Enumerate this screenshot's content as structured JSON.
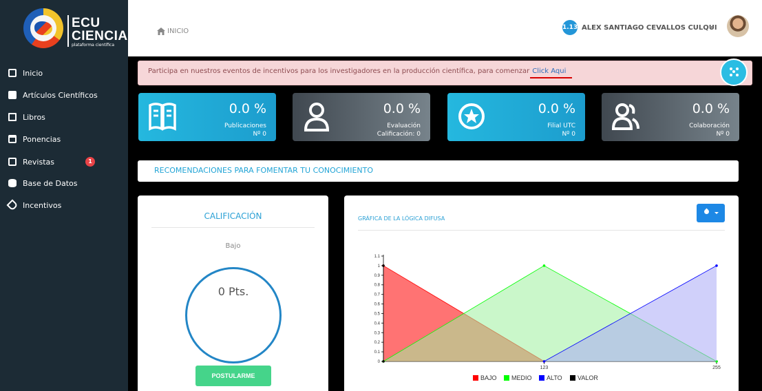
{
  "brand": {
    "line1": "ECU",
    "line2": "CIENCIA",
    "subtitle": "plataforma científica"
  },
  "sidebar": {
    "items": [
      {
        "label": "Inicio",
        "icon": "square-icon"
      },
      {
        "label": "Artículos Científicos",
        "icon": "edit-icon"
      },
      {
        "label": "Libros",
        "icon": "book-icon"
      },
      {
        "label": "Ponencias",
        "icon": "calendar-icon"
      },
      {
        "label": "Revistas",
        "icon": "newspaper-icon",
        "badge": "1"
      },
      {
        "label": "Base de Datos",
        "icon": "database-icon"
      },
      {
        "label": "Incentivos",
        "icon": "tag-icon"
      }
    ]
  },
  "topbar": {
    "breadcrumb": "INICIO",
    "level": "1.13",
    "user_name": "ALEX SANTIAGO CEVALLOS CULQUI"
  },
  "alert": {
    "text": "Participa en nuestros eventos de incentivos para los investigadores en la producción científica, para comenzar",
    "link": "Click Aqui"
  },
  "cards": [
    {
      "percent": "0.0 %",
      "line1": "Publicaciones",
      "line2": "Nº 0",
      "icon": "book-open-icon",
      "color": "#25b8df"
    },
    {
      "percent": "0.0 %",
      "line1": "Evaluación",
      "line2": "Calificación: 0",
      "icon": "user-icon",
      "color": "#5a646c"
    },
    {
      "percent": "0.0 %",
      "line1": "Filial UTC",
      "line2": "Nº 0",
      "icon": "star-circle-icon",
      "color": "#25b8df"
    },
    {
      "percent": "0.0 %",
      "line1": "Colaboración",
      "line2": "Nº 0",
      "icon": "users-icon",
      "color": "#5a646c"
    }
  ],
  "recommendations": "RECOMENDACIONES PARA FOMENTAR TU CONOCIMIENTO",
  "rating": {
    "title": "CALIFICACIÓN",
    "level": "Bajo",
    "points": "0 Pts.",
    "button": "POSTULARME"
  },
  "chart_panel": {
    "title": "GRÁFICA DE LA LÓGICA DIFUSA"
  },
  "chart_data": {
    "type": "area",
    "y_ticks": [
      "0",
      "0.1",
      "0.2",
      "0.3",
      "0.4",
      "0.5",
      "0.6",
      "0.7",
      "0.8",
      "0.9",
      "1",
      "1.1"
    ],
    "x_ticks": [
      "123",
      "255"
    ],
    "xlim": [
      0,
      255
    ],
    "ylim": [
      0,
      1.1
    ],
    "series": [
      {
        "name": "BAJO",
        "color": "#ff0000",
        "fill": "#ff0000",
        "points": [
          [
            0,
            1
          ],
          [
            123,
            0
          ]
        ]
      },
      {
        "name": "MEDIO",
        "color": "#00ff00",
        "fill": "#9ef09e",
        "points": [
          [
            0,
            0
          ],
          [
            123,
            1
          ],
          [
            255,
            0
          ]
        ]
      },
      {
        "name": "ALTO",
        "color": "#0000ff",
        "fill": "#aaaaf6",
        "points": [
          [
            123,
            0
          ],
          [
            255,
            1
          ]
        ]
      },
      {
        "name": "VALOR",
        "color": "#000000",
        "fill": "#000000",
        "points": [
          [
            0,
            1
          ],
          [
            0,
            0
          ]
        ]
      }
    ]
  }
}
